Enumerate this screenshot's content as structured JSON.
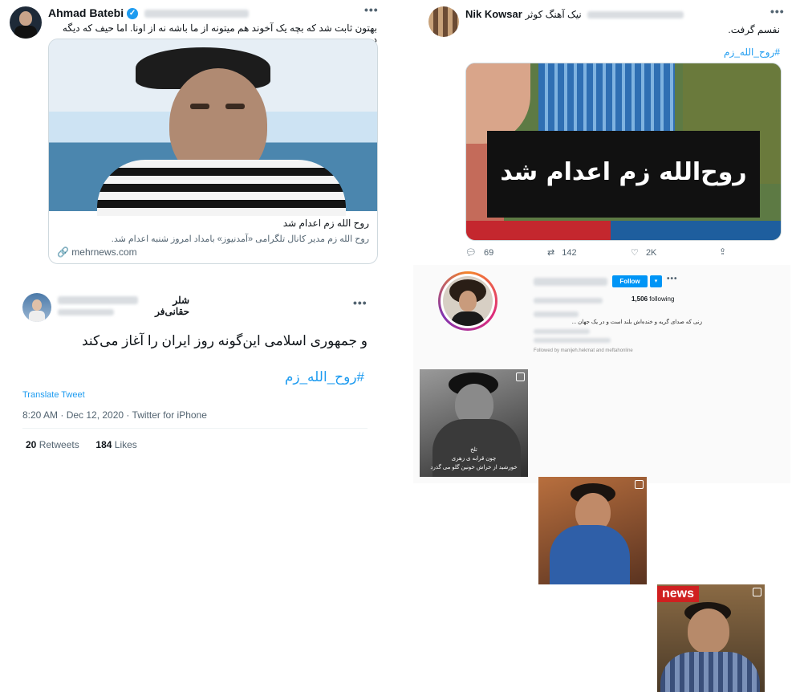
{
  "tweet1": {
    "name": "Ahmad Batebi",
    "text": "بهتون ثابت شد که  بچه یک آخوند هم میتونه از ما باشه نه از اونا. اما حیف که  دیگه دیره.",
    "card": {
      "title": "روح الله زم اعدام شد",
      "desc": "روح الله زم مدیر کانال تلگرامی «آمدنیوز» بامداد امروز شنبه اعدام شد.",
      "domain": "mehrnews.com"
    }
  },
  "tweet2": {
    "name": "نیک آهنگ کوثر",
    "name_en": "Nik Kowsar",
    "text": "نفسم گرفت.",
    "hashtag": "#روح_الله_زم",
    "image_caption": "روح‌الله زم اعدام شد",
    "replies": "69",
    "retweets": "142",
    "likes": "2K"
  },
  "tweet3": {
    "name": "شلر حقانی‌فر",
    "text": "و جمهوری اسلامی این‌گونه روز ایران را آغاز می‌کند",
    "hashtag": "#روح_الله_زم",
    "translate": "Translate Tweet",
    "timestamp": "8:20 AM · Dec 12, 2020 · Twitter for iPhone",
    "retweets_count": "20",
    "retweets_label": "Retweets",
    "likes_count": "184",
    "likes_label": "Likes"
  },
  "instagram": {
    "follow": "Follow",
    "following_count": "1,506",
    "following_label": "following",
    "bio": "زنی که صدای گریه و خنده‌اش بلند است و در یک جهان ...",
    "followed_by": "Followed by manijeh.hekmat and meftahonline",
    "posts": [
      {
        "caption_1": "تلخ",
        "caption_2": "چون قرابه ی زهری",
        "caption_3": "خورشید از خراش خونین گلو می گذرد"
      },
      {},
      {
        "logo": "news"
      }
    ]
  },
  "icons": {
    "more": "more-icon",
    "reply": "reply-icon",
    "retweet": "retweet-icon",
    "like": "heart-icon",
    "share": "share-icon",
    "link": "link-icon",
    "verified": "verified-icon"
  }
}
